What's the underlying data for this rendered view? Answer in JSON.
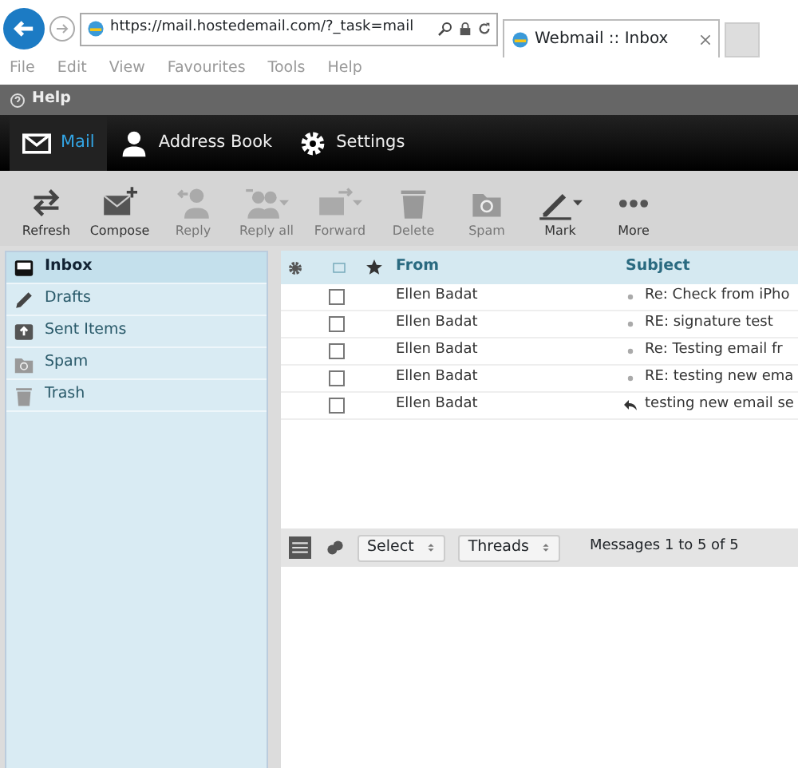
{
  "browser": {
    "url": "https://mail.hostedemail.com/?_task=mail",
    "tab_title": "Webmail :: Inbox",
    "menu": [
      "File",
      "Edit",
      "View",
      "Favourites",
      "Tools",
      "Help"
    ]
  },
  "help_bar": {
    "label": "Help"
  },
  "nav": [
    {
      "label": "Mail",
      "selected": true
    },
    {
      "label": "Address Book",
      "selected": false
    },
    {
      "label": "Settings",
      "selected": false
    }
  ],
  "toolbar": [
    {
      "label": "Refresh",
      "disabled": false,
      "dropdown": false
    },
    {
      "label": "Compose",
      "disabled": false,
      "dropdown": false
    },
    {
      "label": "Reply",
      "disabled": true,
      "dropdown": false
    },
    {
      "label": "Reply all",
      "disabled": true,
      "dropdown": true
    },
    {
      "label": "Forward",
      "disabled": true,
      "dropdown": true
    },
    {
      "label": "Delete",
      "disabled": true,
      "dropdown": false
    },
    {
      "label": "Spam",
      "disabled": true,
      "dropdown": false
    },
    {
      "label": "Mark",
      "disabled": false,
      "dropdown": true
    },
    {
      "label": "More",
      "disabled": false,
      "dropdown": false
    }
  ],
  "folders": [
    {
      "label": "Inbox",
      "selected": true
    },
    {
      "label": "Drafts",
      "selected": false
    },
    {
      "label": "Sent Items",
      "selected": false
    },
    {
      "label": "Spam",
      "selected": false
    },
    {
      "label": "Trash",
      "selected": false
    }
  ],
  "table": {
    "columns": [
      "From",
      "Subject"
    ],
    "rows": [
      {
        "from": "Ellen Badat",
        "subject": "Re: Check from iPho",
        "kind": "read",
        "checked": false
      },
      {
        "from": "Ellen Badat",
        "subject": "RE: signature test",
        "kind": "read",
        "checked": false
      },
      {
        "from": "Ellen Badat",
        "subject": "Re: Testing email fr",
        "kind": "read",
        "checked": false
      },
      {
        "from": "Ellen Badat",
        "subject": "RE: testing new ema",
        "kind": "read",
        "checked": false
      },
      {
        "from": "Ellen Badat",
        "subject": "testing new email se",
        "kind": "replied",
        "checked": false
      }
    ]
  },
  "list_footer": {
    "select": "Select",
    "threads": "Threads",
    "count": "Messages 1 to 5 of 5"
  }
}
